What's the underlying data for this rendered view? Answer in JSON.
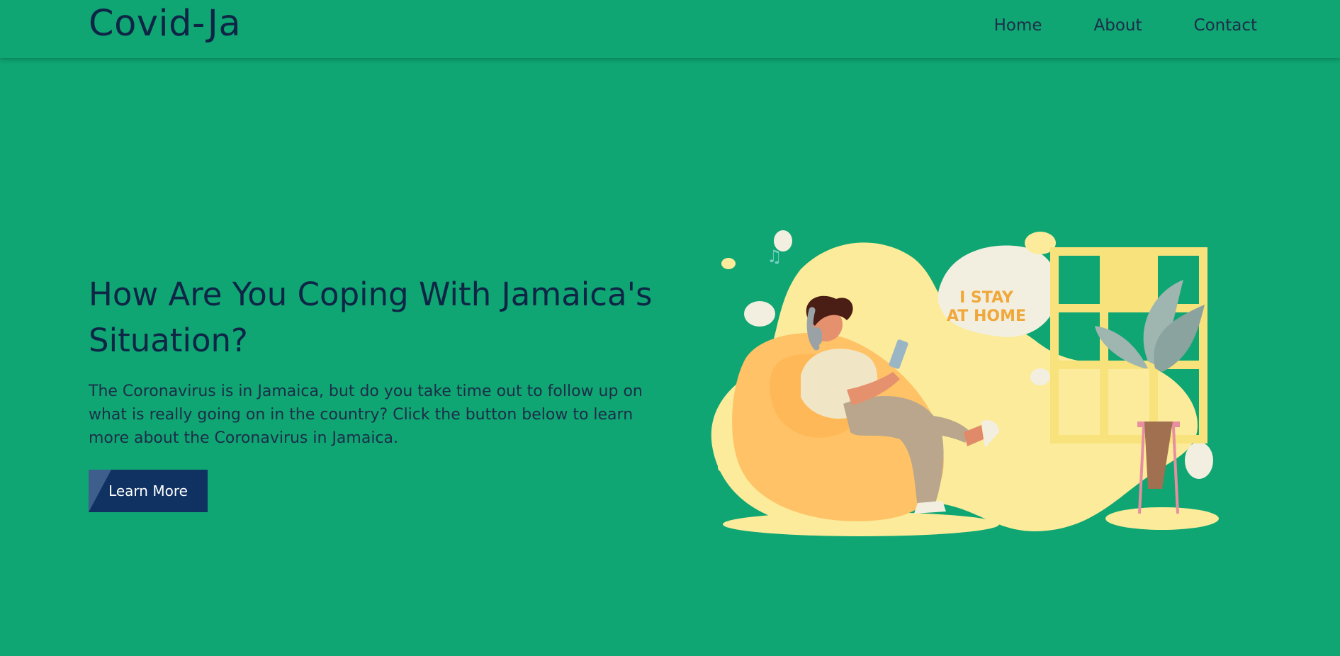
{
  "navbar": {
    "brand": "Covid-Ja",
    "links": [
      {
        "label": "Home"
      },
      {
        "label": "About"
      },
      {
        "label": "Contact"
      }
    ]
  },
  "hero": {
    "title": "How Are You Coping With Jamaica's Situation?",
    "description": "The Coronavirus is in Jamaica, but do you take time out to follow up on what is really going on in the country? Click the button below to learn more about the Coronavirus in Jamaica.",
    "button_label": "Learn More"
  },
  "illustration": {
    "bubble_line1": "I STAY",
    "bubble_line2": "AT HOME"
  },
  "colors": {
    "background": "#0fa673",
    "text_dark": "#0f2546",
    "button": "#0f3262"
  }
}
